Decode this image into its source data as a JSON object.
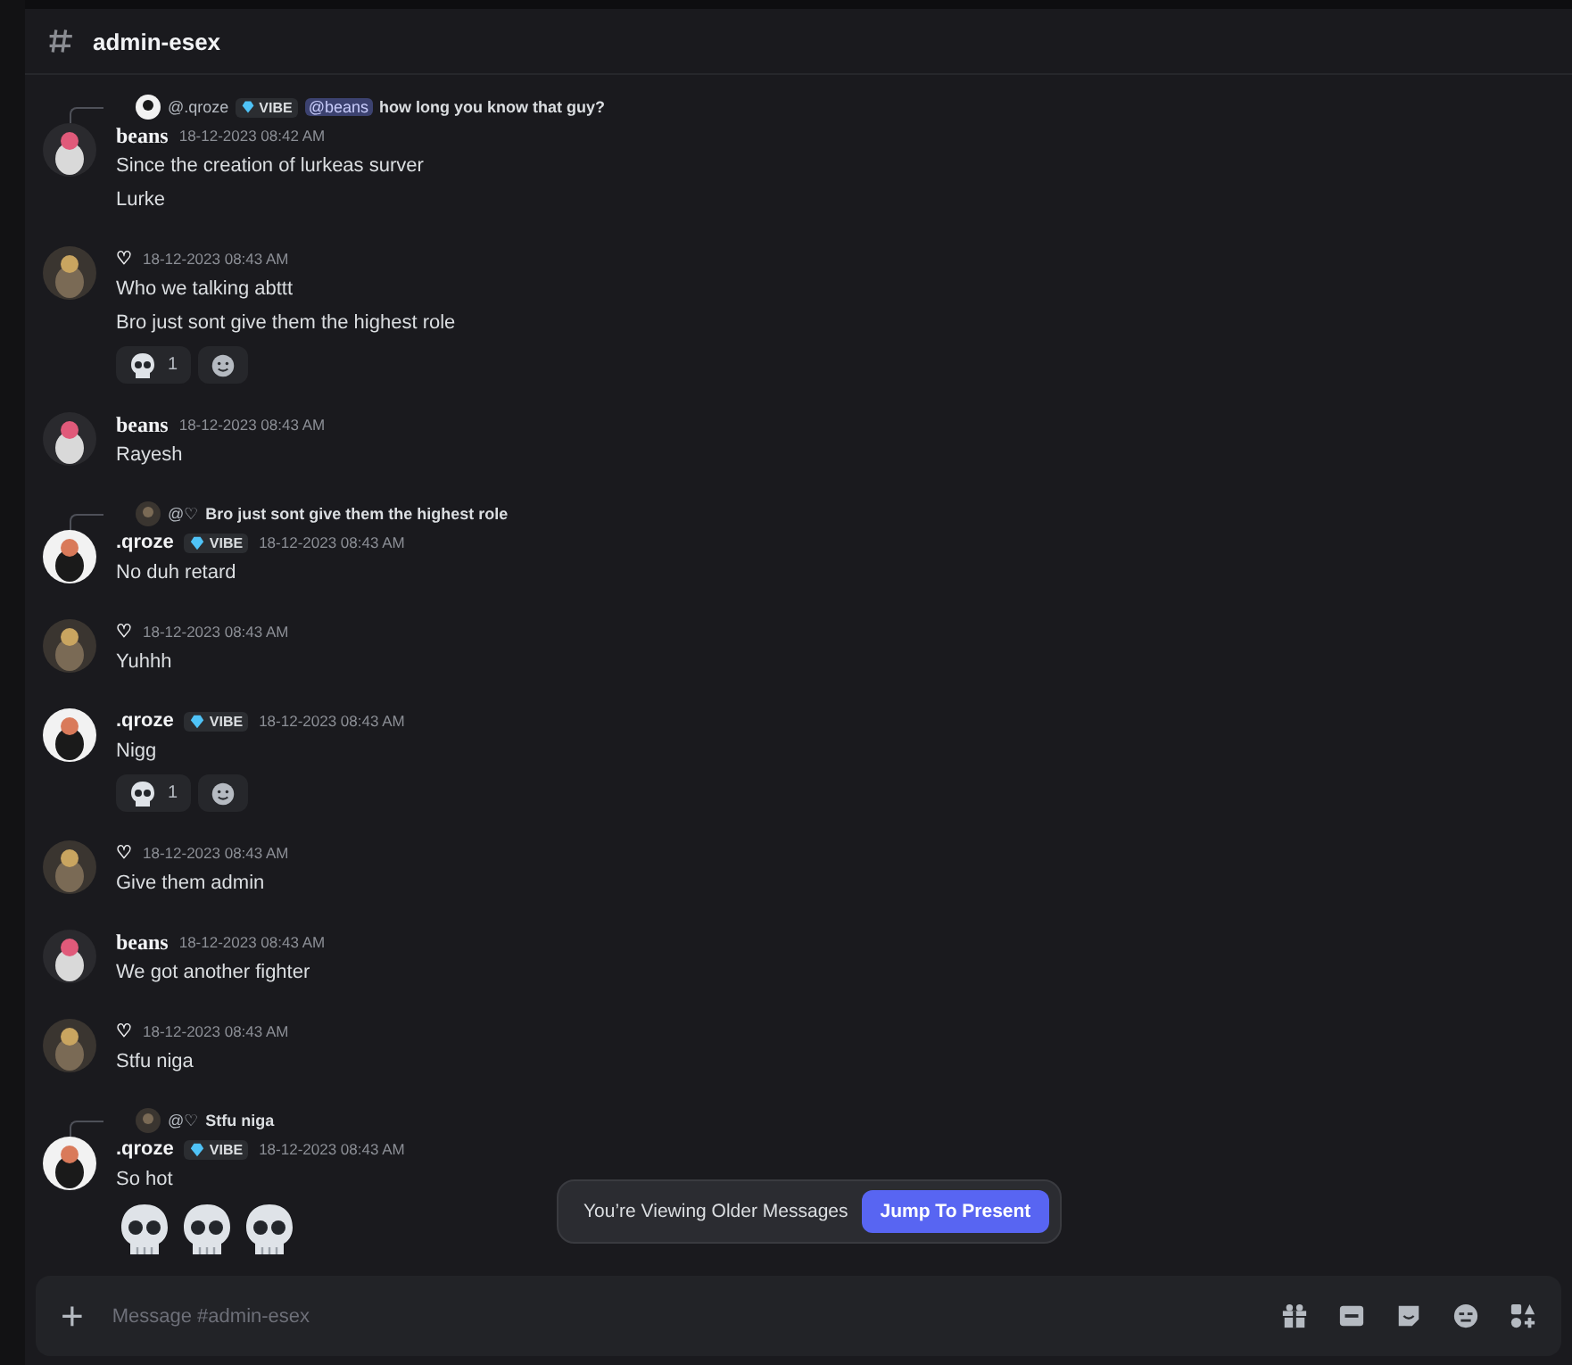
{
  "channel": {
    "name": "admin-esex"
  },
  "messages": [
    {
      "kind": "beans",
      "author": "beans",
      "timestamp": "18-12-2023 08:42 AM",
      "reply": {
        "author": "@.qroze",
        "badge": "VIBE",
        "mention": "@beans",
        "text": "how long you know that guy?"
      },
      "lines": [
        "Since the creation of lurkeas surver",
        "Lurke"
      ]
    },
    {
      "kind": "heart",
      "author": "♡",
      "timestamp": "18-12-2023 08:43 AM",
      "lines": [
        "Who we talking abttt",
        "Bro just sont give them the highest role"
      ],
      "reactions": [
        {
          "kind": "skull",
          "count": "1"
        },
        {
          "kind": "add"
        }
      ]
    },
    {
      "kind": "beans",
      "author": "beans",
      "timestamp": "18-12-2023 08:43 AM",
      "lines": [
        "Rayesh"
      ]
    },
    {
      "kind": "qroze",
      "author": ".qroze",
      "badge": "VIBE",
      "timestamp": "18-12-2023 08:43 AM",
      "reply": {
        "author": "@♡",
        "text": "Bro just sont give them the highest role"
      },
      "lines": [
        "No duh retard"
      ]
    },
    {
      "kind": "heart",
      "author": "♡",
      "timestamp": "18-12-2023 08:43 AM",
      "lines": [
        "Yuhhh"
      ]
    },
    {
      "kind": "qroze",
      "author": ".qroze",
      "badge": "VIBE",
      "timestamp": "18-12-2023 08:43 AM",
      "lines": [
        "Nigg"
      ],
      "reactions": [
        {
          "kind": "skull",
          "count": "1"
        },
        {
          "kind": "add"
        }
      ]
    },
    {
      "kind": "heart",
      "author": "♡",
      "timestamp": "18-12-2023 08:43 AM",
      "lines": [
        "Give them admin"
      ]
    },
    {
      "kind": "beans",
      "author": "beans",
      "timestamp": "18-12-2023 08:43 AM",
      "lines": [
        "We got another fighter"
      ]
    },
    {
      "kind": "heart",
      "author": "♡",
      "timestamp": "18-12-2023 08:43 AM",
      "lines": [
        "Stfu niga"
      ]
    },
    {
      "kind": "qroze",
      "author": ".qroze",
      "badge": "VIBE",
      "timestamp": "18-12-2023 08:43 AM",
      "reply": {
        "author": "@♡",
        "text": "Stfu niga"
      },
      "lines": [
        "So hot"
      ],
      "big_emojis": [
        {
          "kind": "skull"
        },
        {
          "kind": "skull"
        },
        {
          "kind": "skull"
        }
      ]
    }
  ],
  "banner": {
    "text": "You’re Viewing Older Messages",
    "button": "Jump To Present"
  },
  "composer": {
    "placeholder": "Message #admin-esex",
    "plus": "+"
  }
}
